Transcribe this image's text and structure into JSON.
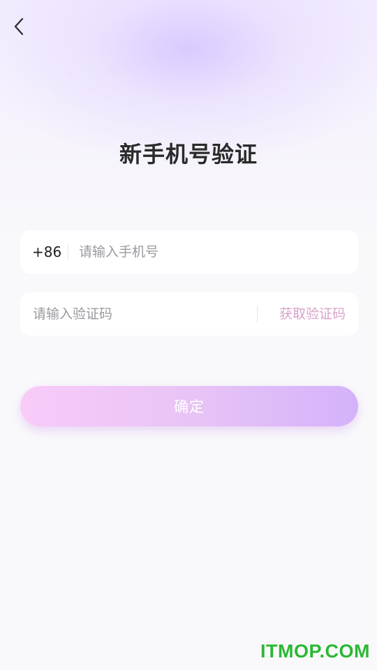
{
  "header": {
    "back_icon": "chevron-left-icon"
  },
  "page": {
    "title": "新手机号验证"
  },
  "phone_field": {
    "country_code": "+86",
    "value": "",
    "placeholder": "请输入手机号"
  },
  "code_field": {
    "value": "",
    "placeholder": "请输入验证码",
    "get_code_label": "获取验证码"
  },
  "confirm_button": {
    "label": "确定"
  },
  "watermark": {
    "text": "ITMOP.COM"
  },
  "colors": {
    "accent_start": "#f8cbf8",
    "accent_end": "#d4b2fa",
    "get_code_text": "#d7a3c9",
    "watermark": "#2bb833"
  }
}
